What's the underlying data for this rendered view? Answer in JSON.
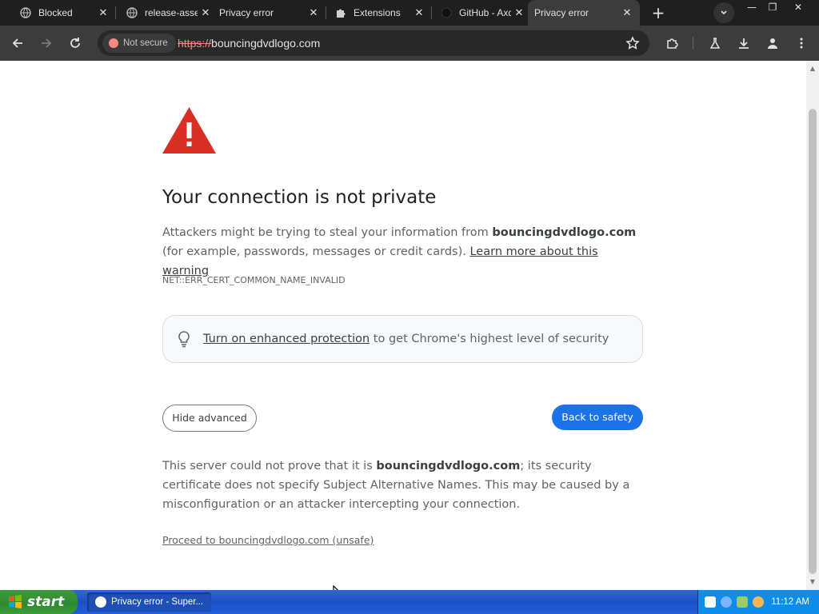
{
  "browser": {
    "tabs": [
      {
        "title": "Blocked",
        "active": false
      },
      {
        "title": "release-assets",
        "active": false
      },
      {
        "title": "Privacy error",
        "active": false
      },
      {
        "title": "Extensions",
        "active": false
      },
      {
        "title": "GitHub - Axd",
        "active": false
      },
      {
        "title": "Privacy error",
        "active": true
      }
    ],
    "security_chip": "Not secure",
    "url_scheme": "https://",
    "url_host": "bouncingdvdlogo.com"
  },
  "page": {
    "heading": "Your connection is not private",
    "desc_prefix": "Attackers might be trying to steal your information from ",
    "desc_domain": "bouncingdvdlogo.com",
    "desc_suffix": " (for example, passwords, messages or credit cards). ",
    "learn_more": "Learn more about this warning",
    "error_code": "NET::ERR_CERT_COMMON_NAME_INVALID",
    "enhanced_link": "Turn on enhanced protection",
    "enhanced_rest": " to get Chrome's highest level of security",
    "hide_advanced": "Hide advanced",
    "back_to_safety": "Back to safety",
    "details_prefix": "This server could not prove that it is ",
    "details_domain": "bouncingdvdlogo.com",
    "details_suffix": "; its security certificate does not specify Subject Alternative Names. This may be caused by a misconfiguration or an attacker intercepting your connection.",
    "proceed": "Proceed to bouncingdvdlogo.com (unsafe)"
  },
  "taskbar": {
    "start": "start",
    "window_item": "Privacy error - Super...",
    "clock": "11:12 AM"
  },
  "colors": {
    "warning_red": "#d93025",
    "primary_blue": "#1a73e8",
    "not_secure_red": "#f28b82"
  }
}
